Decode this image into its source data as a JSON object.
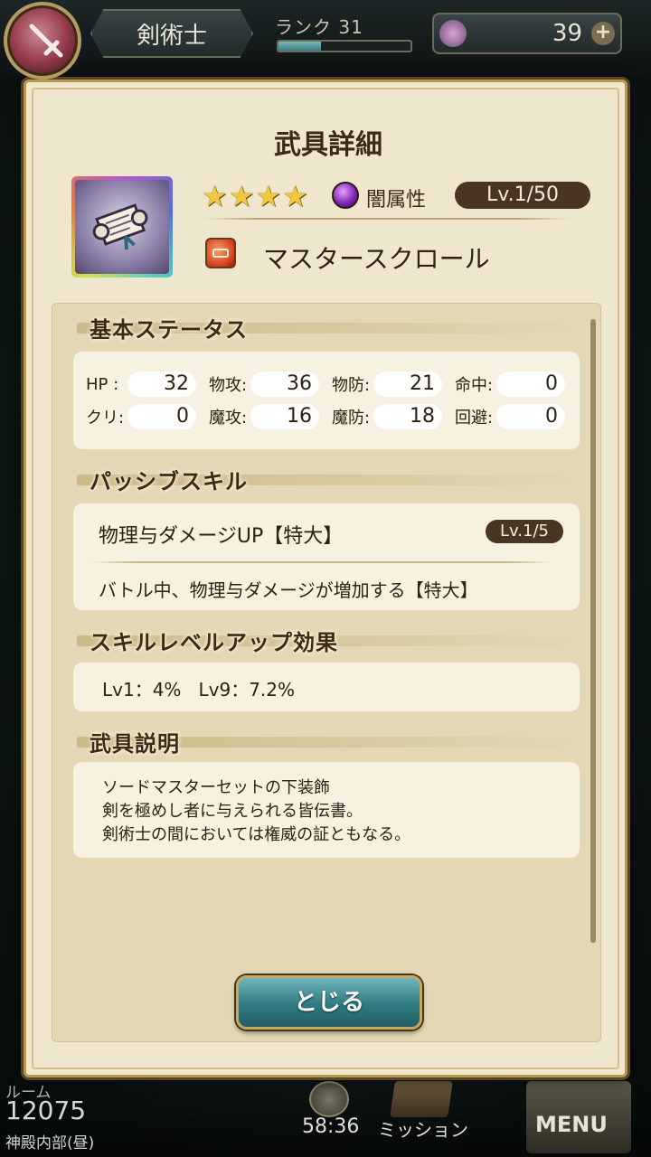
{
  "header": {
    "job": "剣術士",
    "rank_label": "ランク 31",
    "rank_progress": 0.32,
    "gems": "39"
  },
  "footer": {
    "room_label": "ルーム",
    "room_number": "12075",
    "location": "神殿内部(昼)",
    "timer": "58:36",
    "mission": "ミッション",
    "menu": "MENU"
  },
  "dialog": {
    "title": "武具詳細",
    "rarity_stars": 4,
    "attribute": "闇属性",
    "level": "Lv.1/50",
    "weapon_name": "マスタースクロール",
    "sections": {
      "basic_status": "基本ステータス",
      "passive_skill": "パッシブスキル",
      "skill_levelup": "スキルレベルアップ効果",
      "description": "武具説明"
    },
    "stats": [
      [
        {
          "label": "HP :",
          "value": "32"
        },
        {
          "label": "物攻:",
          "value": "36"
        },
        {
          "label": "物防:",
          "value": "21"
        },
        {
          "label": "命中:",
          "value": "0"
        }
      ],
      [
        {
          "label": "クリ:",
          "value": "0"
        },
        {
          "label": "魔攻:",
          "value": "16"
        },
        {
          "label": "魔防:",
          "value": "18"
        },
        {
          "label": "回避:",
          "value": "0"
        }
      ]
    ],
    "skill": {
      "name": "物理与ダメージUP【特大】",
      "level": "Lv.1/5",
      "description": "バトル中、物理与ダメージが増加する【特大】"
    },
    "levelup_effect": "Lv1：4%   Lv9：7.2%",
    "description_lines": [
      "ソードマスターセットの下装飾",
      "剣を極めし者に与えられる皆伝書。",
      "剣術士の間においては権威の証ともなる。"
    ],
    "close_label": "とじる"
  },
  "colors": {
    "parchment": "#efe7cd",
    "gold_border": "#b39852",
    "pill_brown": "#4a3424",
    "button_teal": "#2f7a82"
  }
}
